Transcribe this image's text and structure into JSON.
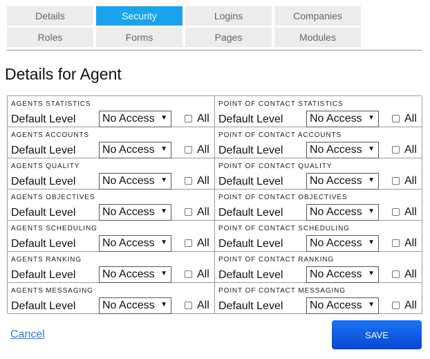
{
  "tabs": {
    "row1": [
      {
        "label": "Details",
        "active": false
      },
      {
        "label": "Security",
        "active": true
      },
      {
        "label": "Logins",
        "active": false
      },
      {
        "label": "Companies",
        "active": false
      }
    ],
    "row2": [
      {
        "label": "Roles",
        "active": false
      },
      {
        "label": "Forms",
        "active": false
      },
      {
        "label": "Pages",
        "active": false
      },
      {
        "label": "Modules",
        "active": false
      }
    ]
  },
  "page_title": "Details for Agent",
  "permissions": {
    "level_label": "Default Level",
    "all_label": "All",
    "rows": [
      {
        "left": {
          "title": "AGENTS STATISTICS",
          "value": "No Access"
        },
        "right": {
          "title": "POINT OF CONTACT STATISTICS",
          "value": "No Access"
        }
      },
      {
        "left": {
          "title": "AGENTS ACCOUNTS",
          "value": "No Access"
        },
        "right": {
          "title": "POINT OF CONTACT ACCOUNTS",
          "value": "No Access"
        }
      },
      {
        "left": {
          "title": "AGENTS QUALITY",
          "value": "No Access"
        },
        "right": {
          "title": "POINT OF CONTACT QUALITY",
          "value": "No Access"
        }
      },
      {
        "left": {
          "title": "AGENTS OBJECTIVES",
          "value": "No Access"
        },
        "right": {
          "title": "POINT OF CONTACT OBJECTIVES",
          "value": "No Access"
        }
      },
      {
        "left": {
          "title": "AGENTS SCHEDULING",
          "value": "No Access"
        },
        "right": {
          "title": "POINT OF CONTACT SCHEDULING",
          "value": "No Access"
        }
      },
      {
        "left": {
          "title": "AGENTS RANKING",
          "value": "No Access"
        },
        "right": {
          "title": "POINT OF CONTACT RANKING",
          "value": "No Access"
        }
      },
      {
        "left": {
          "title": "AGENTS MESSAGING",
          "value": "No Access"
        },
        "right": {
          "title": "POINT OF CONTACT MESSAGING",
          "value": "No Access"
        }
      }
    ]
  },
  "footer": {
    "cancel_label": "Cancel",
    "save_label": "SAVE"
  },
  "colors": {
    "active_tab": "#1aa3ef",
    "inactive_tab": "#ececec",
    "save_button": "#0a5ae0",
    "link": "#2a7be4"
  }
}
